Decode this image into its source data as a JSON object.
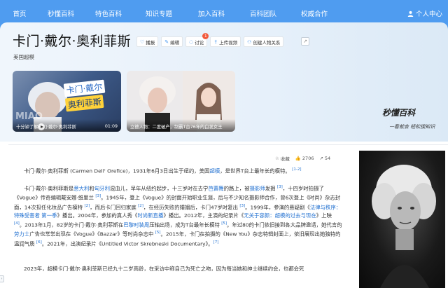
{
  "nav": {
    "items": [
      "首页",
      "秒懂百科",
      "特色百科",
      "知识专题",
      "加入百科",
      "百科团队",
      "权威合作"
    ],
    "user_label": "个人中心"
  },
  "entry": {
    "title": "卡门·戴尔·奥利菲斯",
    "subtitle": "美国超模"
  },
  "actions": [
    {
      "icon": "heart-icon",
      "label": "播报"
    },
    {
      "icon": "edit-icon",
      "label": "编辑"
    },
    {
      "icon": "comment-icon",
      "label": "讨论",
      "badge": "1"
    },
    {
      "icon": "upload-icon",
      "label": "上传视频"
    },
    {
      "icon": "relation-icon",
      "label": "创建人物关系"
    }
  ],
  "videos": [
    {
      "caption": "十分钟了解卡门·戴尔·奥利菲斯",
      "duration": "01:09",
      "overlay": [
        "卡门·戴尔",
        "奥利菲斯"
      ],
      "watermark": "MIAO"
    },
    {
      "caption": "立德人物：二度破产，制霸T台76年的白发女王"
    }
  ],
  "brand": {
    "logo": "秒懂百科",
    "slogan": "一看就会 轻松搜知识"
  },
  "toolbar": {
    "collect": "收藏",
    "likes": "2706",
    "shares": "54"
  },
  "article": {
    "p1_a": "卡门·戴尔·奥利菲斯 (Carmen Dell' Orefice)，1931年6月3日出生于纽约，美国",
    "p1_link": "超模",
    "p1_b": "，是世界T台上最年长的模特。",
    "p1_ref": "[1-2]",
    "p2_segments": [
      {
        "t": "卡门·戴尔·奥利菲斯是"
      },
      {
        "t": "意大利",
        "link": true
      },
      {
        "t": "和"
      },
      {
        "t": "匈牙利",
        "link": true
      },
      {
        "t": "混血儿，早年从纽约起步，十三岁时在去学"
      },
      {
        "t": "芭蕾舞",
        "link": true
      },
      {
        "t": "的路上，被"
      },
      {
        "t": "摄影师",
        "link": true
      },
      {
        "t": "发掘 "
      },
      {
        "t": "[3]",
        "sup": true
      },
      {
        "t": "，十四岁时拍摄了《Vogue》传奇编辑戴安娜·维里兰 "
      },
      {
        "t": "[3]",
        "sup": true
      },
      {
        "t": "。1945年，登上《Vogue》的封面开始职业生涯，后与不少知名摄影师合作，曾6次登上《时尚》杂志封面，14次担任化妆品广告模特 "
      },
      {
        "t": "[2]",
        "sup": true
      },
      {
        "t": "，而后卡门回归家庭 "
      },
      {
        "t": "[2]",
        "sup": true
      },
      {
        "t": "，在经历失败的婚姻后，卡门47岁时复出 "
      },
      {
        "t": "[3]",
        "sup": true
      },
      {
        "t": "。1999年，参演的悬疑剧《"
      },
      {
        "t": "法律与秩序：特殊受害者 第一季",
        "link": true
      },
      {
        "t": "》播出。2004年，参加的真人秀《"
      },
      {
        "t": "时尚新直播",
        "link": true
      },
      {
        "t": "》播出。2012年，主演的纪录片《"
      },
      {
        "t": "无关于容颜：超模的过去与现在",
        "link": true
      },
      {
        "t": "》上映 "
      },
      {
        "t": "[4]",
        "sup": true
      },
      {
        "t": "。2013年1月，82岁的卡门·戴尔·奥利菲斯在"
      },
      {
        "t": "巴黎时装周",
        "link": true
      },
      {
        "t": "压轴出场，成为T台最年长模特 "
      },
      {
        "t": "[5]",
        "sup": true
      },
      {
        "t": "。年过80的卡门依旧接到各大品牌邀请，她代言的"
      },
      {
        "t": "劳力士",
        "link": true
      },
      {
        "t": "广告也常常出现在《Vogue》《Bazzar》等时尚杂志中 "
      },
      {
        "t": "[5]",
        "sup": true
      },
      {
        "t": "。2015年，卡门在拍摄的《New You》杂志特辑封面上，依旧展现出她独特的温润气质 "
      },
      {
        "t": "[6]",
        "sup": true
      },
      {
        "t": "。2021年，出演纪录片《Untitled Victor Skrebneski Documentary》。"
      },
      {
        "t": "[7]",
        "sup": true
      }
    ],
    "p3": "2023年，超模卡门·戴尔·奥利菲斯已经九十二岁高龄，在采访中称自己为死亡之吻，因为每当她和绅士继续约会，也都会死"
  }
}
